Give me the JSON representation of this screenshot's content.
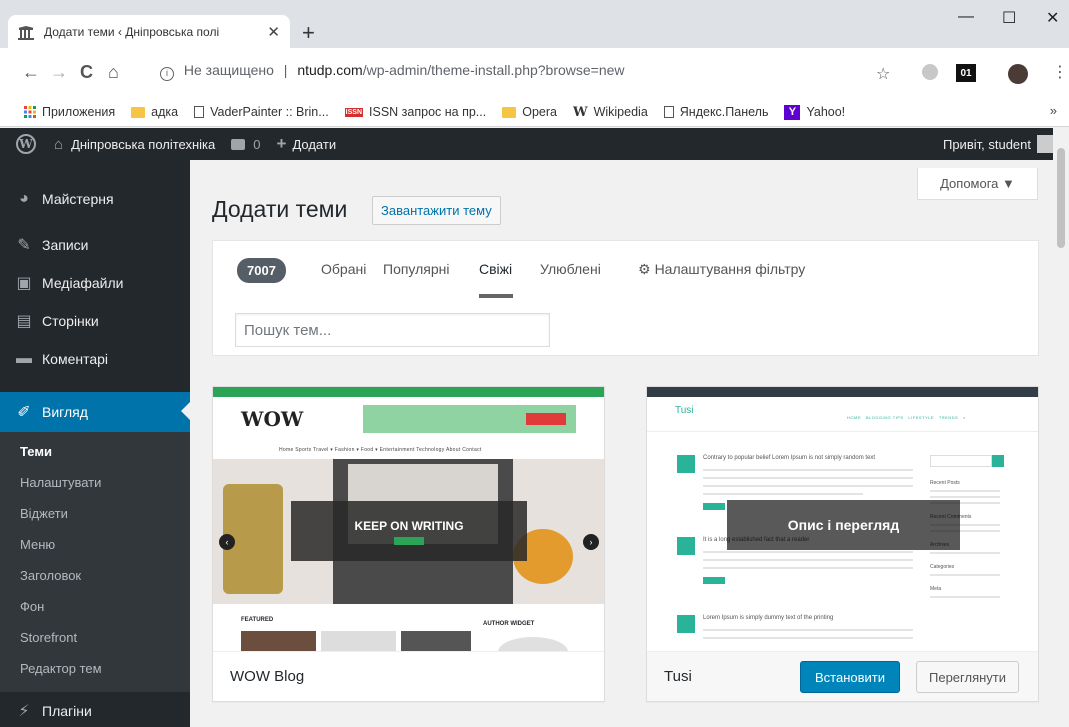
{
  "browser": {
    "tab_title": "Додати теми ‹ Дніпровська полі",
    "new_tab": "+",
    "window": {
      "minimize": "—",
      "maximize": "☐",
      "close": "✕"
    },
    "nav": {
      "back": "←",
      "forward": "→",
      "reload": "C",
      "home": "⌂"
    },
    "address": {
      "security": "Не защищено",
      "host": "ntudp.com",
      "path": "/wp-admin/theme-install.php?browse=new"
    },
    "extensions": {
      "badge": "01"
    },
    "bookmarks": [
      {
        "label": "Приложения",
        "icon": "apps-grid-icon"
      },
      {
        "label": "адка",
        "icon": "folder-icon"
      },
      {
        "label": "VaderPainter :: Brin...",
        "icon": "page-icon"
      },
      {
        "label": "ISSN запрос на пр...",
        "icon": "issn-icon",
        "icon_text": "ISSN"
      },
      {
        "label": "Opera",
        "icon": "folder-icon"
      },
      {
        "label": "Wikipedia",
        "icon": "wikipedia-icon",
        "icon_text": "W"
      },
      {
        "label": "Яндекс.Панель",
        "icon": "page-icon"
      },
      {
        "label": "Yahoo!",
        "icon": "yahoo-icon",
        "icon_text": "Y"
      }
    ],
    "bookmarks_more": "»"
  },
  "adminbar": {
    "site_name": "Дніпровська політехніка",
    "comments_count": "0",
    "add_new": "Додати",
    "greeting": "Привіт, student"
  },
  "sidebar": {
    "items": [
      {
        "label": "Майстерня",
        "icon": "dashboard-icon"
      },
      {
        "label": "Записи",
        "icon": "pin-icon"
      },
      {
        "label": "Медіафайли",
        "icon": "media-icon"
      },
      {
        "label": "Сторінки",
        "icon": "pages-icon"
      },
      {
        "label": "Коментарі",
        "icon": "comment-icon"
      }
    ],
    "active": {
      "label": "Вигляд",
      "icon": "brush-icon"
    },
    "submenu": [
      "Теми",
      "Налаштувати",
      "Віджети",
      "Меню",
      "Заголовок",
      "Фон",
      "Storefront",
      "Редактор тем"
    ],
    "after": {
      "label": "Плагіни",
      "icon": "plugin-icon"
    }
  },
  "main": {
    "help_label": "Допомога ▼",
    "title": "Додати теми",
    "upload_label": "Завантажити тему",
    "count": "7007",
    "filter_tabs": [
      "Обрані",
      "Популярні",
      "Свіжі",
      "Улюблені"
    ],
    "current_tab": "Свіжі",
    "filter_settings": "Налаштування фільтру",
    "search_placeholder": "Пошук тем..."
  },
  "themes": [
    {
      "name": "WOW Blog",
      "preview": {
        "logo": "WOW",
        "nav": "Home   Sports   Travel ▾   Fashion ▾   Food ▾   Entertainment   Technology   About   Contact",
        "hero_text": "KEEP ON WRITING",
        "featured": "FEATURED",
        "author_widget": "AUTHOR WIDGET"
      }
    },
    {
      "name": "Tusi",
      "details_overlay": "Опис і перегляд",
      "install_label": "Встановити",
      "preview_label": "Переглянути",
      "preview": {
        "title": "Tusi",
        "posts": [
          "Contrary to popular belief Lorem Ipsum is not simply random text",
          "It is a long established fact that a reader",
          "Lorem Ipsum is simply dummy text of the printing"
        ],
        "sidebar_headings": [
          "Recent Posts",
          "Recent Comments",
          "Archives",
          "Categories",
          "Meta"
        ]
      }
    }
  ],
  "colors": {
    "wp_blue": "#0073aa",
    "adminbar": "#23282d",
    "wow_green": "#2ba555",
    "tusi_teal": "#2bb39a"
  }
}
